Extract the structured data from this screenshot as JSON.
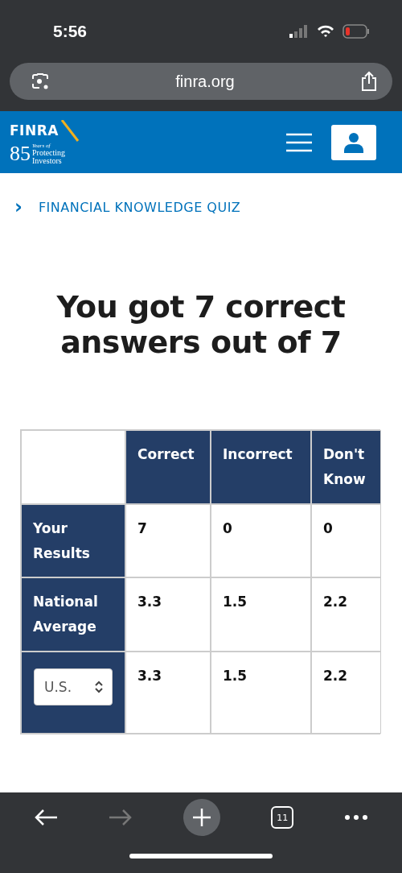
{
  "status_bar": {
    "time": "5:56"
  },
  "browser": {
    "url": "finra.org",
    "tab_count": "11",
    "forward_disabled": true
  },
  "site_header": {
    "logo": {
      "wordmark": "FINRA",
      "years": "85",
      "tagline_1": "Years of",
      "tagline_2": "Protecting",
      "tagline_3": "Investors"
    }
  },
  "breadcrumb": {
    "chevron": "›",
    "label": "FINANCIAL KNOWLEDGE QUIZ"
  },
  "heading": "You got 7 correct answers out of 7",
  "results_table": {
    "columns": [
      "Correct",
      "Incorrect",
      "Don't Know"
    ],
    "rows": [
      {
        "kind": "label",
        "label": "Your Results",
        "values": [
          "7",
          "0",
          "0"
        ]
      },
      {
        "kind": "label",
        "label": "National Average",
        "values": [
          "3.3",
          "1.5",
          "2.2"
        ]
      },
      {
        "kind": "select",
        "select_value": "U.S.",
        "values": [
          "3.3",
          "1.5",
          "2.2"
        ]
      }
    ]
  }
}
